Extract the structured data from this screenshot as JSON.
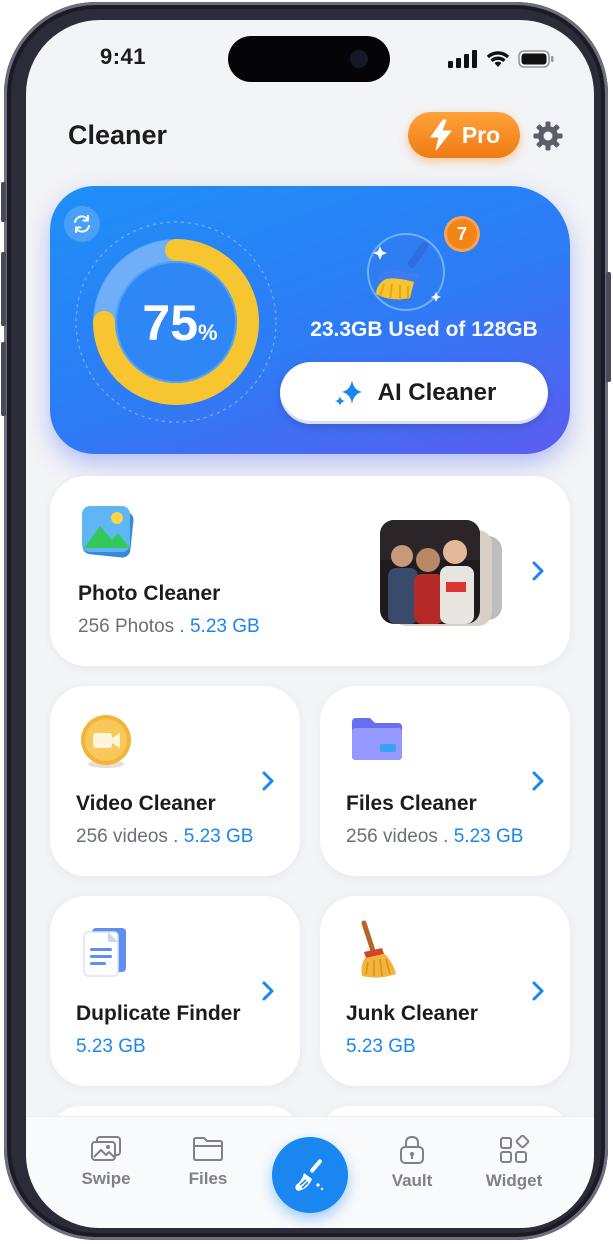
{
  "status_bar": {
    "time": "9:41"
  },
  "header": {
    "title": "Cleaner",
    "pro_label": "Pro"
  },
  "hero": {
    "percent": "75",
    "percent_symbol": "%",
    "usage_fraction": 0.75,
    "badge_count": "7",
    "used": "23.3GB",
    "of_total": "Used of 128GB",
    "ai_button": "AI Cleaner"
  },
  "cards": {
    "photo": {
      "title": "Photo Cleaner",
      "count": "256 Photos",
      "separator": " . ",
      "size": "5.23 GB"
    },
    "video": {
      "title": "Video Cleaner",
      "count": "256 videos",
      "separator": " . ",
      "size": "5.23 GB"
    },
    "files": {
      "title": "Files Cleaner",
      "count": "256 videos",
      "separator": " . ",
      "size": "5.23 GB"
    },
    "duplicate": {
      "title": "Duplicate Finder",
      "size": "5.23 GB"
    },
    "junk": {
      "title": "Junk Cleaner",
      "size": "5.23 GB"
    }
  },
  "tabbar": {
    "swipe": "Swipe",
    "files": "Files",
    "vault": "Vault",
    "widget": "Widget"
  },
  "colors": {
    "accent": "#1a86f0",
    "pro": "#f07a12",
    "ring": "#f5c530"
  }
}
